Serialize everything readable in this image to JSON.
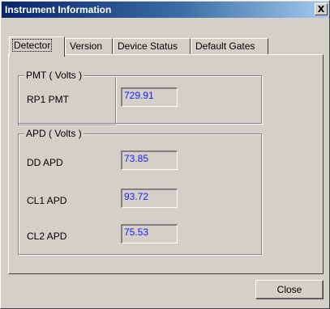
{
  "window": {
    "title": "Instrument Information",
    "close_glyph": "X"
  },
  "tabs": [
    {
      "label": "Detector",
      "selected": true
    },
    {
      "label": "Version",
      "selected": false
    },
    {
      "label": "Device Status",
      "selected": false
    },
    {
      "label": "Default Gates",
      "selected": false
    }
  ],
  "pmt_group": {
    "legend": "PMT ( Volts )",
    "rows": [
      {
        "label": "RP1 PMT",
        "value": "729.91"
      }
    ]
  },
  "apd_group": {
    "legend": "APD ( Volts )",
    "rows": [
      {
        "label": "DD APD",
        "value": "73.85"
      },
      {
        "label": "CL1 APD",
        "value": "93.72"
      },
      {
        "label": "CL2 APD",
        "value": "75.53"
      }
    ]
  },
  "footer": {
    "close_label": "Close"
  },
  "colors": {
    "title_bar_start": "#0a246a",
    "title_bar_end": "#a6caf0",
    "value_text": "#1a1aff",
    "dialog_face": "#d4d0c8"
  }
}
